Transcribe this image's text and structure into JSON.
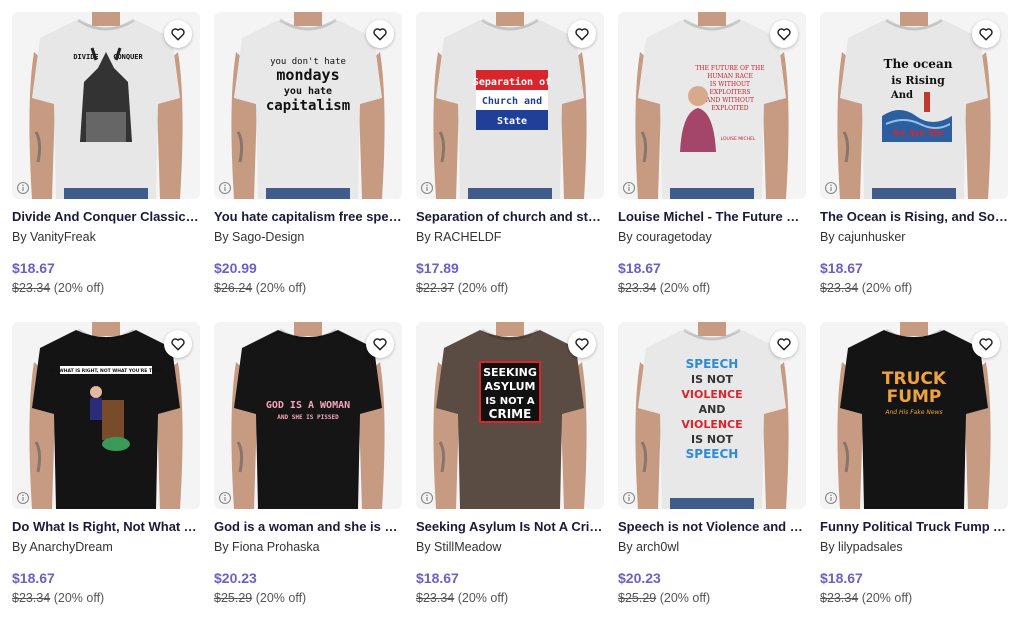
{
  "products": [
    {
      "title": "Divide And Conquer Classic T-...",
      "artist": "By VanityFreak",
      "price": "$18.67",
      "original_price": "$23.34",
      "discount": "(20% off)",
      "shirt_color": "#e7e7e7",
      "print_lines": [
        "DIVIDE",
        "CONQUER"
      ],
      "print_fg": "#111111",
      "print_style": "art-dark"
    },
    {
      "title": "You hate capitalism free speec...",
      "artist": "By Sago-Design",
      "price": "$20.99",
      "original_price": "$26.24",
      "discount": "(20% off)",
      "shirt_color": "#e8e8e8",
      "print_lines": [
        "you don't hate",
        "mondays",
        "you hate",
        "capitalism"
      ],
      "print_fg": "#111111",
      "print_style": "text"
    },
    {
      "title": "Separation of church and state...",
      "artist": "By RACHELDF",
      "price": "$17.89",
      "original_price": "$22.37",
      "discount": "(20% off)",
      "shirt_color": "#e6e6e6",
      "print_lines": [
        "Separation of",
        "Church and",
        "State"
      ],
      "print_fg": "#ffffff",
      "print_style": "flag"
    },
    {
      "title": "Louise Michel - The Future Of ...",
      "artist": "By couragetoday",
      "price": "$18.67",
      "original_price": "$23.34",
      "discount": "(20% off)",
      "shirt_color": "#e9e9e9",
      "print_lines": [
        "THE FUTURE OF THE",
        "HUMAN RACE",
        "IS WITHOUT",
        "EXPLOITERS",
        "AND WITHOUT",
        "EXPLOITED",
        "LOUISE MICHEL"
      ],
      "print_fg": "#c0262d",
      "print_style": "portrait"
    },
    {
      "title": "The Ocean is Rising, and So Ar...",
      "artist": "By cajunhusker",
      "price": "$18.67",
      "original_price": "$23.34",
      "discount": "(20% off)",
      "shirt_color": "#e7e7e7",
      "print_lines": [
        "The ocean",
        "is Rising",
        "And",
        "So Are We"
      ],
      "print_fg": "#111111",
      "print_style": "ocean"
    },
    {
      "title": "Do What Is Right, Not What Yo...",
      "artist": "By AnarchyDream",
      "price": "$18.67",
      "original_price": "$23.34",
      "discount": "(20% off)",
      "shirt_color": "#141414",
      "print_lines": [
        "DO WHAT IS RIGHT, NOT WHAT YOU'RE TOLD"
      ],
      "print_fg": "#ffffff",
      "print_style": "cartoon"
    },
    {
      "title": "God is a woman and she is pis...",
      "artist": "By Fiona Prohaska",
      "price": "$20.23",
      "original_price": "$25.29",
      "discount": "(20% off)",
      "shirt_color": "#151515",
      "print_lines": [
        "GOD IS A WOMAN",
        "AND SHE IS PISSED"
      ],
      "print_fg": "#f2a7b8",
      "print_style": "text-small"
    },
    {
      "title": "Seeking Asylum Is Not A Crime...",
      "artist": "By StillMeadow",
      "price": "$18.67",
      "original_price": "$23.34",
      "discount": "(20% off)",
      "shirt_color": "#5a4b43",
      "print_lines": [
        "SEEKING",
        "ASYLUM",
        "IS NOT A",
        "CRIME"
      ],
      "print_fg": "#ffffff",
      "print_style": "boxed"
    },
    {
      "title": "Speech is not Violence and Vio...",
      "artist": "By arch0wl",
      "price": "$20.23",
      "original_price": "$25.29",
      "discount": "(20% off)",
      "shirt_color": "#e8e8e8",
      "print_lines": [
        "SPEECH",
        "IS NOT",
        "VIOLENCE",
        "AND",
        "VIOLENCE",
        "IS NOT",
        "SPEECH"
      ],
      "print_fg": "#2e8bd8",
      "print_style": "speech"
    },
    {
      "title": "Funny Political Truck Fump An...",
      "artist": "By lilypadsales",
      "price": "$18.67",
      "original_price": "$23.34",
      "discount": "(20% off)",
      "shirt_color": "#141414",
      "print_lines": [
        "TRUCK",
        "FUMP",
        "And His Fake News"
      ],
      "print_fg": "#f0a33a",
      "print_style": "fump"
    }
  ],
  "icons": {
    "favorite": "heart-icon",
    "info": "info-icon"
  },
  "colors": {
    "price": "#6c5fc7",
    "title": "#1a1a3a",
    "background_wall": "#f4f4f4"
  }
}
